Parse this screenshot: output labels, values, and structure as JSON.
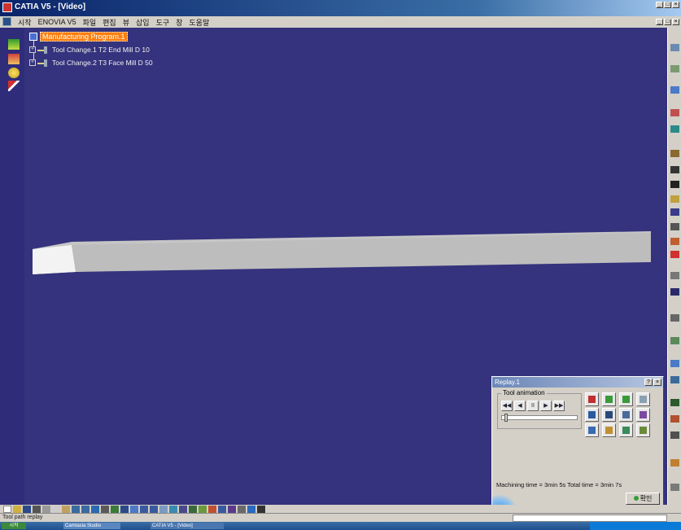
{
  "window": {
    "title": "CATIA V5 - [Video]",
    "min_label": "_",
    "max_label": "□",
    "close_label": "×"
  },
  "menubar": {
    "items": [
      "시작",
      "ENOVIA V5",
      "파일",
      "편집",
      "뷰",
      "삽입",
      "도구",
      "창",
      "도움말"
    ]
  },
  "tree": {
    "root": "Manufacturing Program.1",
    "nodes": [
      {
        "label": "Tool Change.1  T2 End Mill D 10"
      },
      {
        "label": "Tool Change.2  T3 Face Mill D 50"
      }
    ]
  },
  "replay_dialog": {
    "title": "Replay.1",
    "help_label": "?",
    "close_label": "×",
    "section_label": "Tool animation",
    "buttons": [
      "◀◀",
      "◀",
      "II",
      "▶",
      "▶▶"
    ],
    "progress": 0.03,
    "time_text": "Machining time = 3min 5s   Total time = 3min 7s",
    "ok_label": "확인"
  },
  "status": {
    "text": "Tool path replay"
  },
  "taskbar": {
    "start_label": "시작",
    "task1_label": "Camtasia Studio",
    "task2_label": "CATIA V5 - [Video]"
  },
  "colors": {
    "viewport_bg": "#35337d",
    "root_highlight": "#ff7f10",
    "part_top": "#c9c9c9",
    "part_end": "#f2f2f2",
    "part_front": "#b3b3b3"
  }
}
